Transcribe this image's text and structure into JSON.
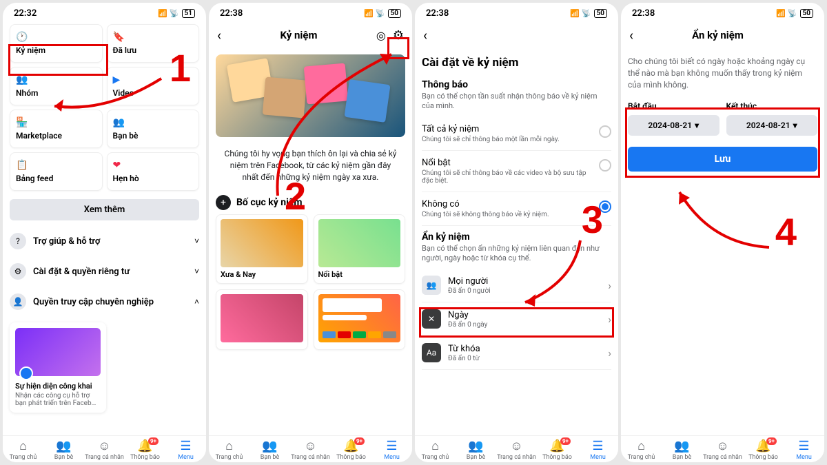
{
  "status": {
    "time1": "22:32",
    "time2": "22:38",
    "time3": "22:38",
    "time4": "22:38",
    "battery1": "51",
    "battery2": "50",
    "battery3": "50",
    "battery4": "50"
  },
  "screen1": {
    "tiles": [
      {
        "label": "Kỷ niệm",
        "icon": "🕐",
        "color": "#1877f2"
      },
      {
        "label": "Đã lưu",
        "icon": "🔖",
        "color": "#a033b5"
      },
      {
        "label": "Nhóm",
        "icon": "👥",
        "color": "#1877f2"
      },
      {
        "label": "Video",
        "icon": "▶",
        "color": "#1877f2"
      },
      {
        "label": "Marketplace",
        "icon": "🏪",
        "color": "#1877f2"
      },
      {
        "label": "Bạn bè",
        "icon": "👥",
        "color": "#1877f2"
      },
      {
        "label": "Bảng feed",
        "icon": "📋",
        "color": "#1877f2"
      },
      {
        "label": "Hẹn hò",
        "icon": "❤",
        "color": "#f02849"
      }
    ],
    "see_more": "Xem thêm",
    "rows": [
      {
        "label": "Trợ giúp & hỗ trợ",
        "icon": "?"
      },
      {
        "label": "Cài đặt & quyền riêng tư",
        "icon": "⚙"
      },
      {
        "label": "Quyền truy cập chuyên nghiệp",
        "icon": "👤",
        "expanded": true
      }
    ],
    "card": {
      "title": "Sự hiện diện công khai",
      "sub": "Nhận các công cụ hỗ trợ bạn phát triển trên Faceb…"
    }
  },
  "screen2": {
    "title": "Kỷ niệm",
    "desc": "Chúng tôi hy vọng bạn thích ôn lại và chia sẻ kỷ niệm trên Facebook, từ các kỷ niệm gần đây nhất đến những kỷ niệm ngày xa xưa.",
    "section": "Bố cục kỷ niệm",
    "layouts": [
      {
        "label": "Xưa & Nay"
      },
      {
        "label": "Nổi bật"
      }
    ]
  },
  "screen3": {
    "h1": "Cài đặt về kỷ niệm",
    "notif_h": "Thông báo",
    "notif_sub": "Bạn có thể chọn tần suất nhận thông báo về kỷ niệm của mình.",
    "radios": [
      {
        "label": "Tất cả kỷ niệm",
        "sub": "Chúng tôi sẽ chỉ thông báo một lần mỗi ngày."
      },
      {
        "label": "Nổi bật",
        "sub": "Chúng tôi sẽ chỉ thông báo về các video và bộ sưu tập đặc biệt."
      },
      {
        "label": "Không có",
        "sub": "Chúng tôi sẽ không thông báo về kỷ niệm.",
        "selected": true
      }
    ],
    "hide_h": "Ẩn kỷ niệm",
    "hide_sub": "Bạn có thể chọn ẩn những kỷ niệm liên quan đến như người, ngày hoặc từ khóa cụ thể.",
    "actions": [
      {
        "label": "Mọi người",
        "sub": "Đã ẩn 0 người",
        "icon": "👥"
      },
      {
        "label": "Ngày",
        "sub": "Đã ẩn 0 ngày",
        "icon": "✕"
      },
      {
        "label": "Từ khóa",
        "sub": "Đã ẩn 0 từ",
        "icon": "Aa"
      }
    ]
  },
  "screen4": {
    "title": "Ẩn kỷ niệm",
    "help": "Cho chúng tôi biết có ngày hoặc khoảng ngày cụ thể nào mà bạn không muốn thấy trong kỷ niệm của mình không.",
    "start_label": "Bắt đầu",
    "end_label": "Kết thúc",
    "start_date": "2024-08-21",
    "end_date": "2024-08-21",
    "save": "Lưu"
  },
  "tabs": [
    {
      "label": "Trang chủ",
      "icon": "⌂"
    },
    {
      "label": "Bạn bè",
      "icon": "👥"
    },
    {
      "label": "Trang cá nhân",
      "icon": "☺"
    },
    {
      "label": "Thông báo",
      "icon": "🔔",
      "badge": "9+"
    },
    {
      "label": "Menu",
      "icon": "☰",
      "active": true
    }
  ],
  "annotations": {
    "n1": "1",
    "n2": "2",
    "n3": "3",
    "n4": "4"
  }
}
